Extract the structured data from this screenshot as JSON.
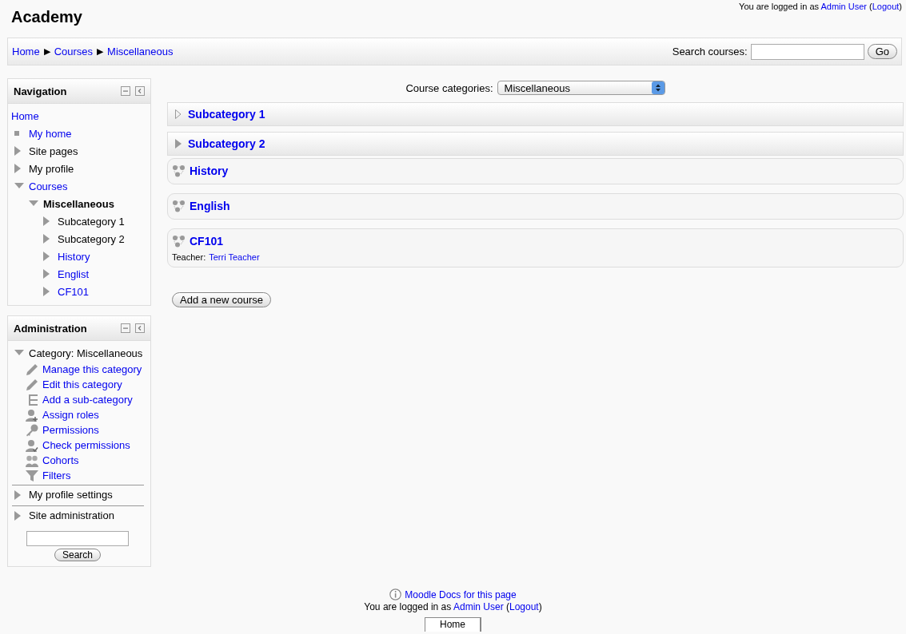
{
  "site_title": "Academy",
  "login_info": [
    {
      "text": "You are logged in as ",
      "link": false
    },
    {
      "text": "Admin User",
      "link": true
    },
    {
      "text": " (",
      "link": false
    },
    {
      "text": "Logout",
      "link": true
    },
    {
      "text": ")",
      "link": false
    }
  ],
  "breadcrumb": [
    {
      "label": "Home",
      "separator": "▶"
    },
    {
      "label": "Courses",
      "separator": "▶"
    },
    {
      "label": "Miscellaneous"
    }
  ],
  "search_courses": {
    "label": "Search courses:",
    "button": "Go"
  },
  "navigation": {
    "title": "Navigation",
    "items": [
      {
        "label": "Home",
        "kind": "root",
        "link": true
      },
      {
        "label": "My home",
        "kind": "leaf",
        "link": true
      },
      {
        "label": "Site pages",
        "kind": "branch",
        "link": false,
        "expanded": false
      },
      {
        "label": "My profile",
        "kind": "branch",
        "link": false,
        "expanded": false
      },
      {
        "label": "Courses",
        "kind": "branch",
        "link": true,
        "expanded": true,
        "children": [
          {
            "label": "Miscellaneous",
            "kind": "branch",
            "link": false,
            "bold": true,
            "expanded": true,
            "children": [
              {
                "label": "Subcategory 1",
                "kind": "branch",
                "link": false,
                "expanded": false
              },
              {
                "label": "Subcategory 2",
                "kind": "branch",
                "link": false,
                "expanded": false
              },
              {
                "label": "History",
                "kind": "branch",
                "link": true,
                "expanded": false
              },
              {
                "label": "Englist",
                "kind": "branch",
                "link": true,
                "expanded": false
              },
              {
                "label": "CF101",
                "kind": "branch",
                "link": true,
                "expanded": false
              }
            ]
          }
        ]
      }
    ]
  },
  "administration": {
    "title": "Administration",
    "category": {
      "label": "Category: Miscellaneous",
      "expanded": true,
      "children": [
        {
          "label": "Manage this category",
          "kind": "pencil"
        },
        {
          "label": "Edit this category",
          "kind": "pencil"
        },
        {
          "label": "Add a sub-category",
          "kind": "tree"
        },
        {
          "label": "Assign roles",
          "kind": "useradd"
        },
        {
          "label": "Permissions",
          "kind": "key"
        },
        {
          "label": "Check permissions",
          "kind": "usercheck"
        },
        {
          "label": "Cohorts",
          "kind": "users"
        },
        {
          "label": "Filters",
          "kind": "funnel"
        }
      ]
    },
    "sections": [
      {
        "label": "My profile settings",
        "expanded": false
      },
      {
        "label": "Site administration",
        "expanded": false
      }
    ],
    "search_button": "Search"
  },
  "course_categories": {
    "label": "Course categories:",
    "value": "Miscellaneous"
  },
  "listing": [
    {
      "kind": "category",
      "title": "Subcategory 1",
      "has_children": false
    },
    {
      "kind": "category",
      "title": "Subcategory 2",
      "has_children": true
    },
    {
      "kind": "course",
      "title": "History"
    },
    {
      "kind": "course",
      "title": "English"
    },
    {
      "kind": "course",
      "title": "CF101",
      "teacher_label": "Teacher:",
      "teacher": "Terri Teacher"
    }
  ],
  "add_course_button": "Add a new course",
  "footer": {
    "docs_link": "Moodle Docs for this page",
    "login_info": [
      {
        "text": "You are logged in as ",
        "link": false
      },
      {
        "text": "Admin User",
        "link": true
      },
      {
        "text": " (",
        "link": false
      },
      {
        "text": "Logout",
        "link": true
      },
      {
        "text": ")",
        "link": false
      }
    ],
    "home_tab": "Home"
  }
}
